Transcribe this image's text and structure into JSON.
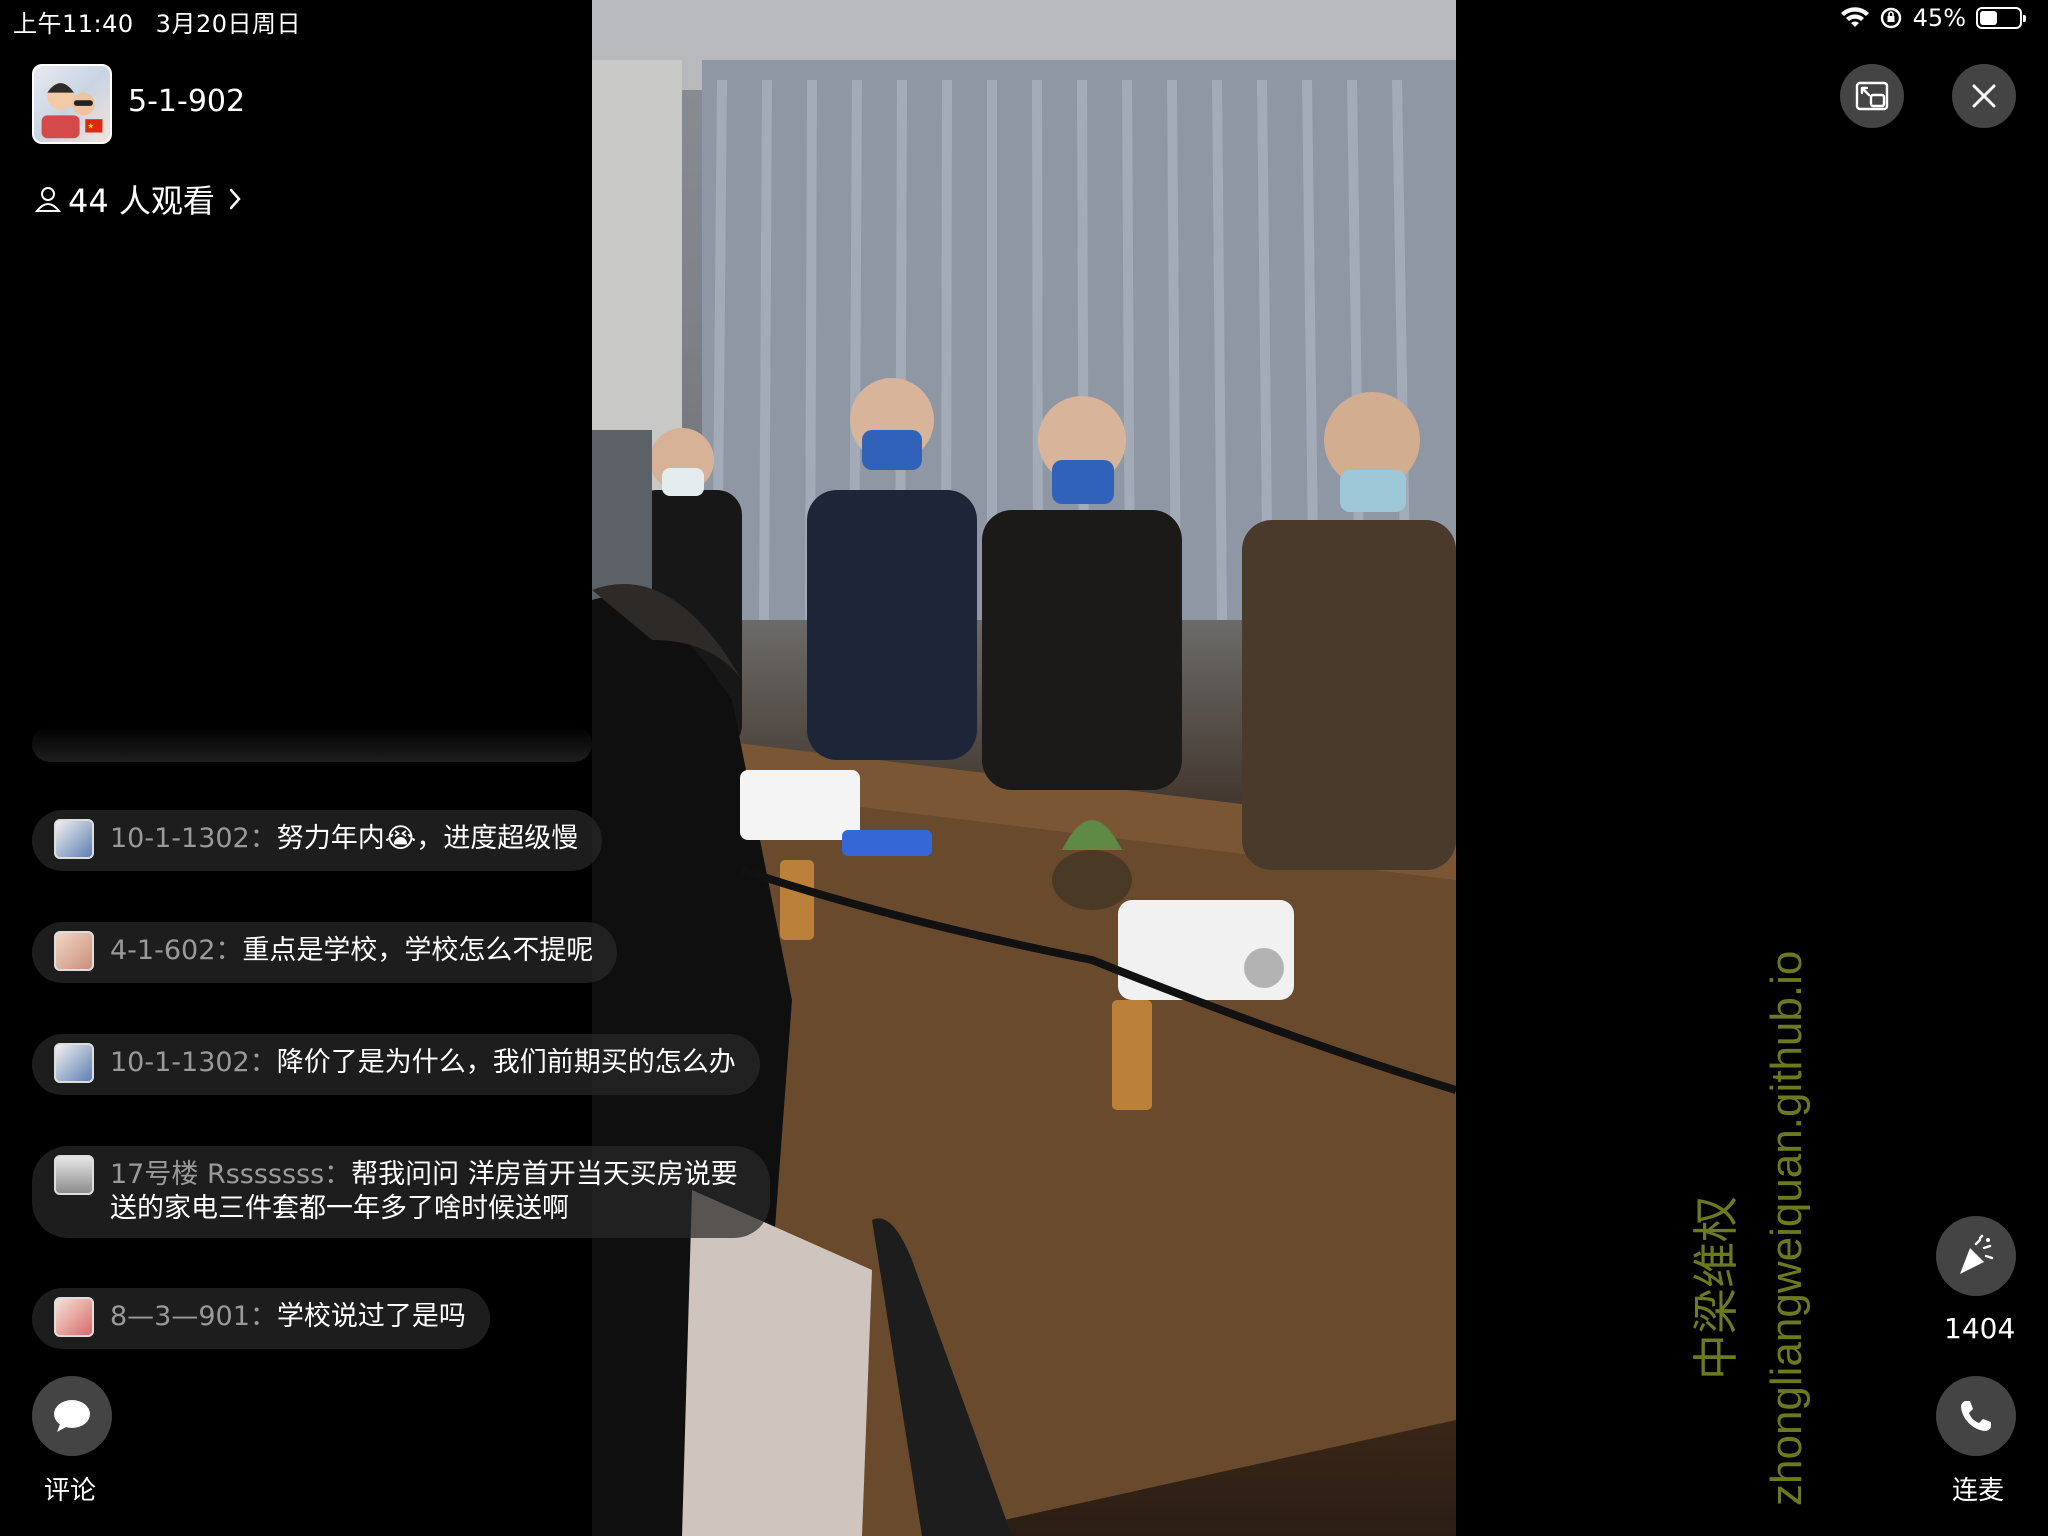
{
  "status_bar": {
    "time": "上午11:40",
    "date": "3月20日周日",
    "battery": "45%",
    "battery_level": 0.45
  },
  "header": {
    "room_title": "5-1-902",
    "viewers": "44 人观看"
  },
  "comments": [
    {
      "author": "10-1-1302",
      "text": "努力年内😭，进度超级慢"
    },
    {
      "author": "4-1-602",
      "text": "重点是学校，学校怎么不提呢"
    },
    {
      "author": "10-1-1302",
      "text": "降价了是为什么，我们前期买的怎么办"
    },
    {
      "author": "17号楼 Rsssssss",
      "text": "帮我问问  洋房首开当天买房说要送的家电三件套都一年多了啥时候送啊"
    },
    {
      "author": "8—3—901",
      "text": "学校说过了是吗"
    }
  ],
  "comment_separator": "：",
  "actions": {
    "comment_label": "评论",
    "like_count": "1404",
    "call_label": "连麦"
  },
  "watermark": {
    "cn": "中梁维权",
    "url": "zhongliangweiquan.github.io"
  },
  "colors": {
    "watermark": "#6b7a1f",
    "bubble": "rgba(40,40,40,0.72)"
  }
}
